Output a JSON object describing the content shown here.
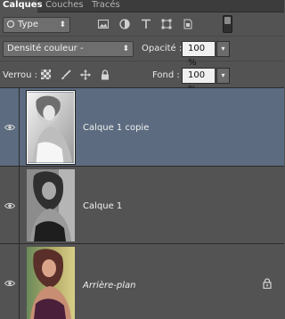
{
  "tabs": [
    {
      "label": "Calques",
      "active": true
    },
    {
      "label": "Couches",
      "active": false
    },
    {
      "label": "Tracés",
      "active": false
    }
  ],
  "filter": {
    "kind_label": "Type",
    "icons": [
      "image-filter-icon",
      "adjustment-filter-icon",
      "text-filter-icon",
      "shape-filter-icon",
      "smart-object-filter-icon"
    ]
  },
  "blend": {
    "mode": "Densité couleur -",
    "opacity_label": "Opacité :",
    "opacity_value": "100 %"
  },
  "lock": {
    "label": "Verrou :",
    "fill_label": "Fond :",
    "fill_value": "100 %"
  },
  "layers": [
    {
      "name": "Calque 1 copie",
      "selected": true,
      "visible": true,
      "italic": false,
      "locked": false
    },
    {
      "name": "Calque 1",
      "selected": false,
      "visible": true,
      "italic": false,
      "locked": false
    },
    {
      "name": "Arrière-plan",
      "selected": false,
      "visible": true,
      "italic": true,
      "locked": true
    }
  ],
  "colors": {
    "panel_bg": "#535353",
    "selected_layer": "#5c6b80",
    "tab_bar": "#3c3c3c"
  }
}
